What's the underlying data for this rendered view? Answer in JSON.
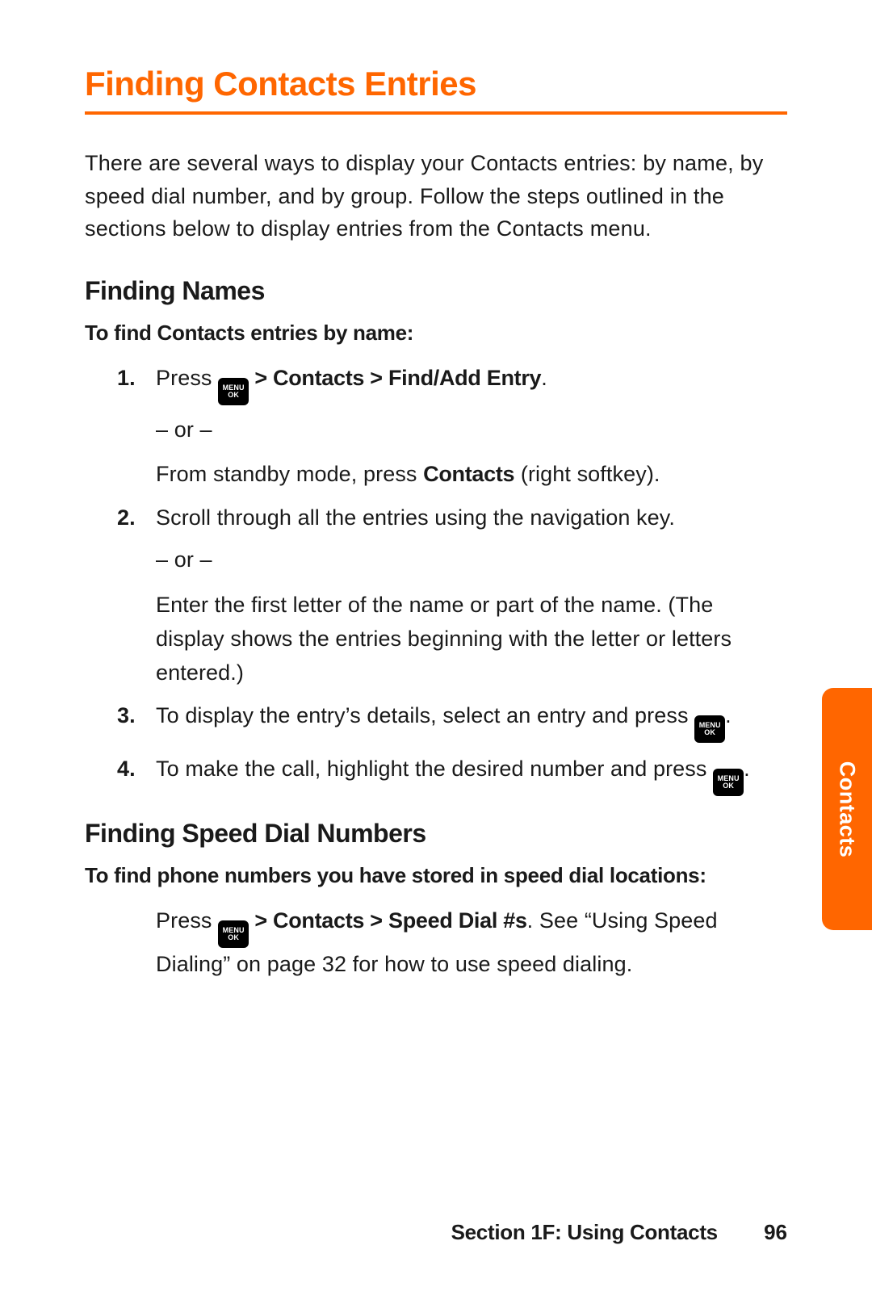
{
  "title": "Finding Contacts Entries",
  "intro": "There are several ways to display your Contacts entries: by name, by speed dial number, and by group. Follow the steps outlined in the sections below to display entries from the Contacts menu.",
  "side_tab": "Contacts",
  "footer": {
    "section": "Section 1F: Using Contacts",
    "page": "96"
  },
  "menu_key": {
    "line1": "MENU",
    "line2": "OK"
  },
  "names": {
    "heading": "Finding Names",
    "lead": "To find Contacts entries by name:",
    "steps": {
      "s1": {
        "num": "1.",
        "press": "Press ",
        "path": " > Contacts > Find/Add Entry",
        "dot": ".",
        "or": "– or –",
        "alt_a": "From standby mode, press ",
        "alt_b": "Contacts",
        "alt_c": " (right softkey)."
      },
      "s2": {
        "num": "2.",
        "line1": "Scroll through all the entries using the navigation key.",
        "or": "– or –",
        "line2": "Enter the first letter of the name or part of the name. (The display shows the entries beginning with the letter or letters entered.)"
      },
      "s3": {
        "num": "3.",
        "a": "To display the entry’s details, select an entry and press ",
        "dot": "."
      },
      "s4": {
        "num": "4.",
        "a": "To make the call, highlight the desired number and press ",
        "dot": "."
      }
    }
  },
  "speed": {
    "heading": "Finding Speed Dial Numbers",
    "lead": "To find phone numbers you have stored in speed dial locations:",
    "press": "Press ",
    "path": " > Contacts > Speed Dial #s",
    "tail": ". See “Using Speed Dialing” on page 32 for how to use speed dialing."
  }
}
